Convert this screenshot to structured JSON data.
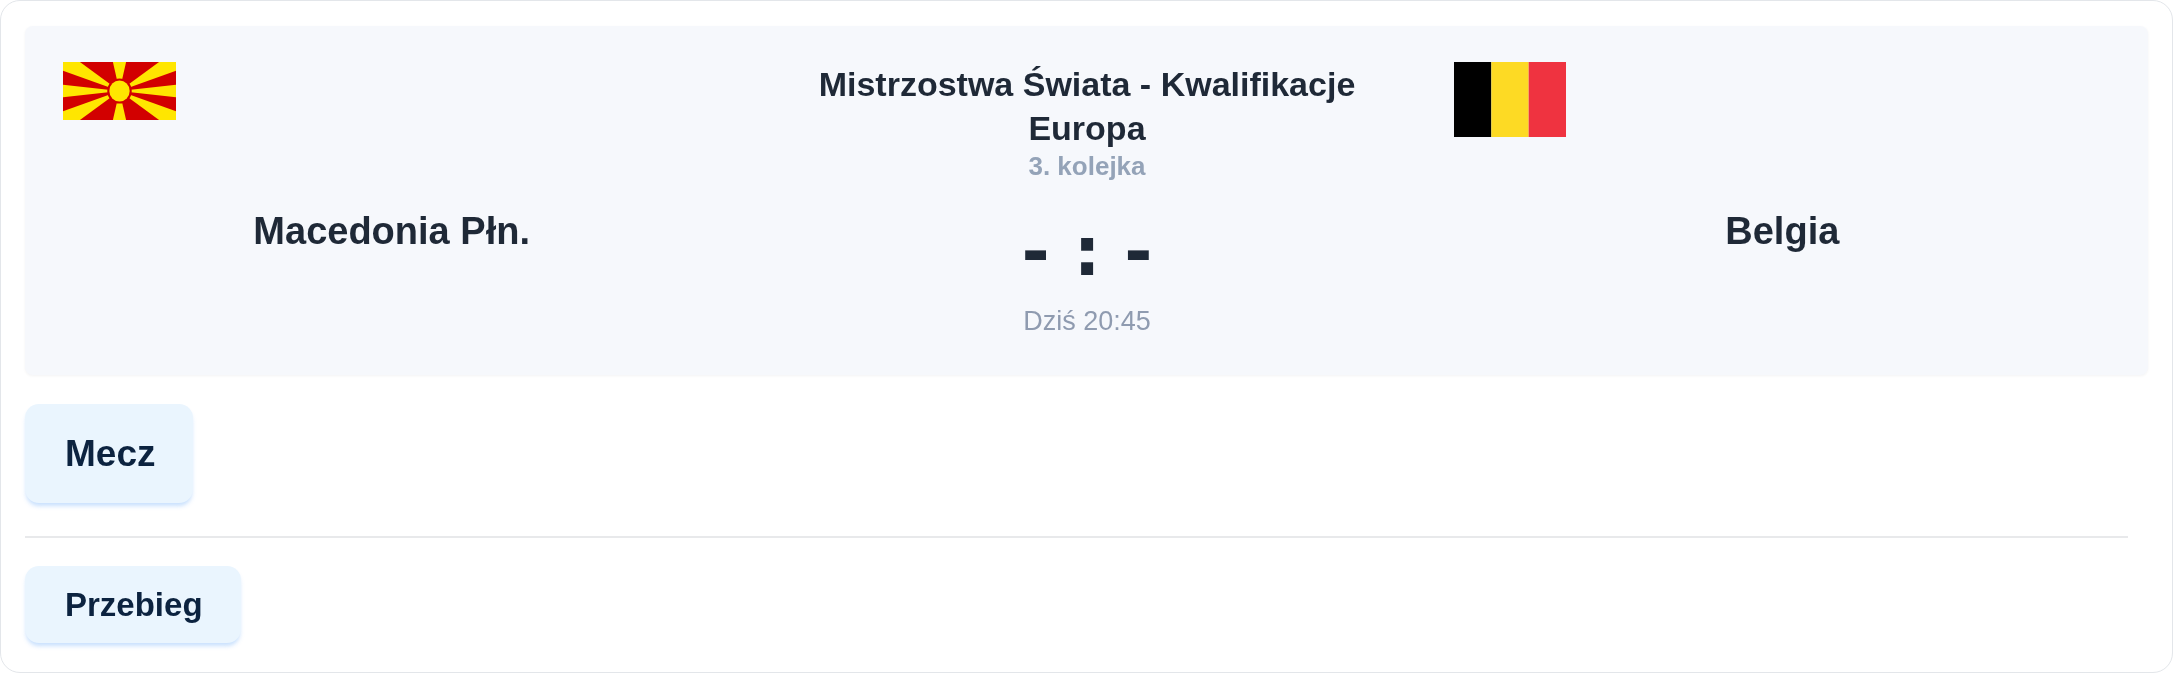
{
  "match": {
    "competition": "Mistrzostwa Świata - Kwalifikacje Europa",
    "round": "3. kolejka",
    "score": "- : -",
    "time": "Dziś 20:45",
    "home": {
      "name": "Macedonia Płn."
    },
    "away": {
      "name": "Belgia"
    }
  },
  "tabs": [
    {
      "label": "Mecz",
      "selected": true
    }
  ],
  "subtabs": [
    {
      "label": "Przebieg",
      "selected": true
    }
  ]
}
